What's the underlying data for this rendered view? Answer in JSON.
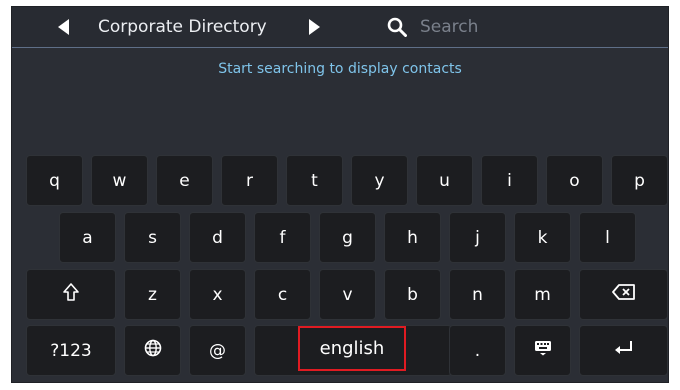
{
  "header": {
    "prev_icon": "triangle-left-icon",
    "title": "Corporate Directory",
    "next_icon": "triangle-right-icon",
    "search_icon": "search-icon",
    "search_placeholder": "Search"
  },
  "info_message": "Start searching to display contacts",
  "keyboard": {
    "row1": [
      "q",
      "w",
      "e",
      "r",
      "t",
      "y",
      "u",
      "i",
      "o",
      "p"
    ],
    "row2": [
      "a",
      "s",
      "d",
      "f",
      "g",
      "h",
      "j",
      "k",
      "l"
    ],
    "row3": [
      "z",
      "x",
      "c",
      "v",
      "b",
      "n",
      "m"
    ],
    "shift_icon": "shift-arrow-icon",
    "backspace_icon": "backspace-icon",
    "numbers_label": "?123",
    "language_icon": "globe-icon",
    "at_label": "@",
    "space_label": "english",
    "period_label": ".",
    "hide_keyboard_icon": "keyboard-icon",
    "enter_icon": "enter-arrow-icon"
  },
  "colors": {
    "background": "#2b2e35",
    "key": "#1c1d20",
    "info_text": "#7fc4ea",
    "highlight": "#e01b22"
  }
}
